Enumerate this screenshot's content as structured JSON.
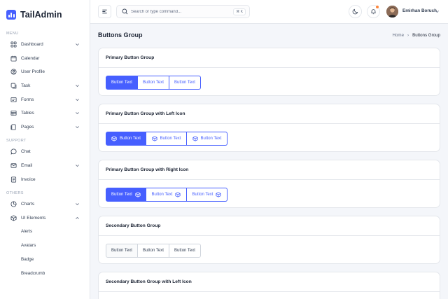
{
  "brand": {
    "name": "TailAdmin"
  },
  "sidebar": {
    "menu_label": "MENU",
    "support_label": "SUPPORT",
    "others_label": "OTHERS",
    "menu_items": [
      {
        "label": "Dashboard",
        "icon": "grid-icon",
        "has_chevron": true
      },
      {
        "label": "Calendar",
        "icon": "calendar-icon",
        "has_chevron": false
      },
      {
        "label": "User Profile",
        "icon": "user-circle-icon",
        "has_chevron": false
      },
      {
        "label": "Task",
        "icon": "task-icon",
        "has_chevron": true
      },
      {
        "label": "Forms",
        "icon": "forms-icon",
        "has_chevron": true
      },
      {
        "label": "Tables",
        "icon": "table-icon",
        "has_chevron": true
      },
      {
        "label": "Pages",
        "icon": "pages-icon",
        "has_chevron": true
      }
    ],
    "support_items": [
      {
        "label": "Chat",
        "icon": "chat-icon",
        "has_chevron": false
      },
      {
        "label": "Email",
        "icon": "mail-icon",
        "has_chevron": true
      },
      {
        "label": "Invoice",
        "icon": "invoice-icon",
        "has_chevron": false
      }
    ],
    "others_items": [
      {
        "label": "Charts",
        "icon": "pie-chart-icon",
        "has_chevron": true
      },
      {
        "label": "UI Elements",
        "icon": "box-icon",
        "has_chevron": true,
        "expanded": true
      }
    ],
    "ui_sub_items": [
      "Alerts",
      "Avatars",
      "Badge",
      "Breadcrumb"
    ]
  },
  "header": {
    "search_placeholder": "Search or type command...",
    "search_shortcut": "⌘ K",
    "user_name": "Emirhan Boruch"
  },
  "page": {
    "title": "Buttons Group",
    "breadcrumb_home": "Home",
    "breadcrumb_separator": "›",
    "breadcrumb_current": "Buttons Group"
  },
  "cards": [
    {
      "title": "Primary Button Group",
      "buttons": [
        "Button Text",
        "Button Text",
        "Button Text"
      ]
    },
    {
      "title": "Primary Button Group with Left Icon",
      "buttons": [
        "Button Text",
        "Button Text",
        "Button Text"
      ]
    },
    {
      "title": "Primary Button Group with Right Icon",
      "buttons": [
        "Button Text",
        "Button Text",
        "Button Text"
      ]
    },
    {
      "title": "Secondary Button Group",
      "buttons": [
        "Button Text",
        "Button Text",
        "Button Text"
      ]
    },
    {
      "title": "Secondary Button Group with Left Icon"
    }
  ],
  "colors": {
    "primary": "#465fff",
    "notification": "#fd853a",
    "border": "#e4e7ec"
  }
}
